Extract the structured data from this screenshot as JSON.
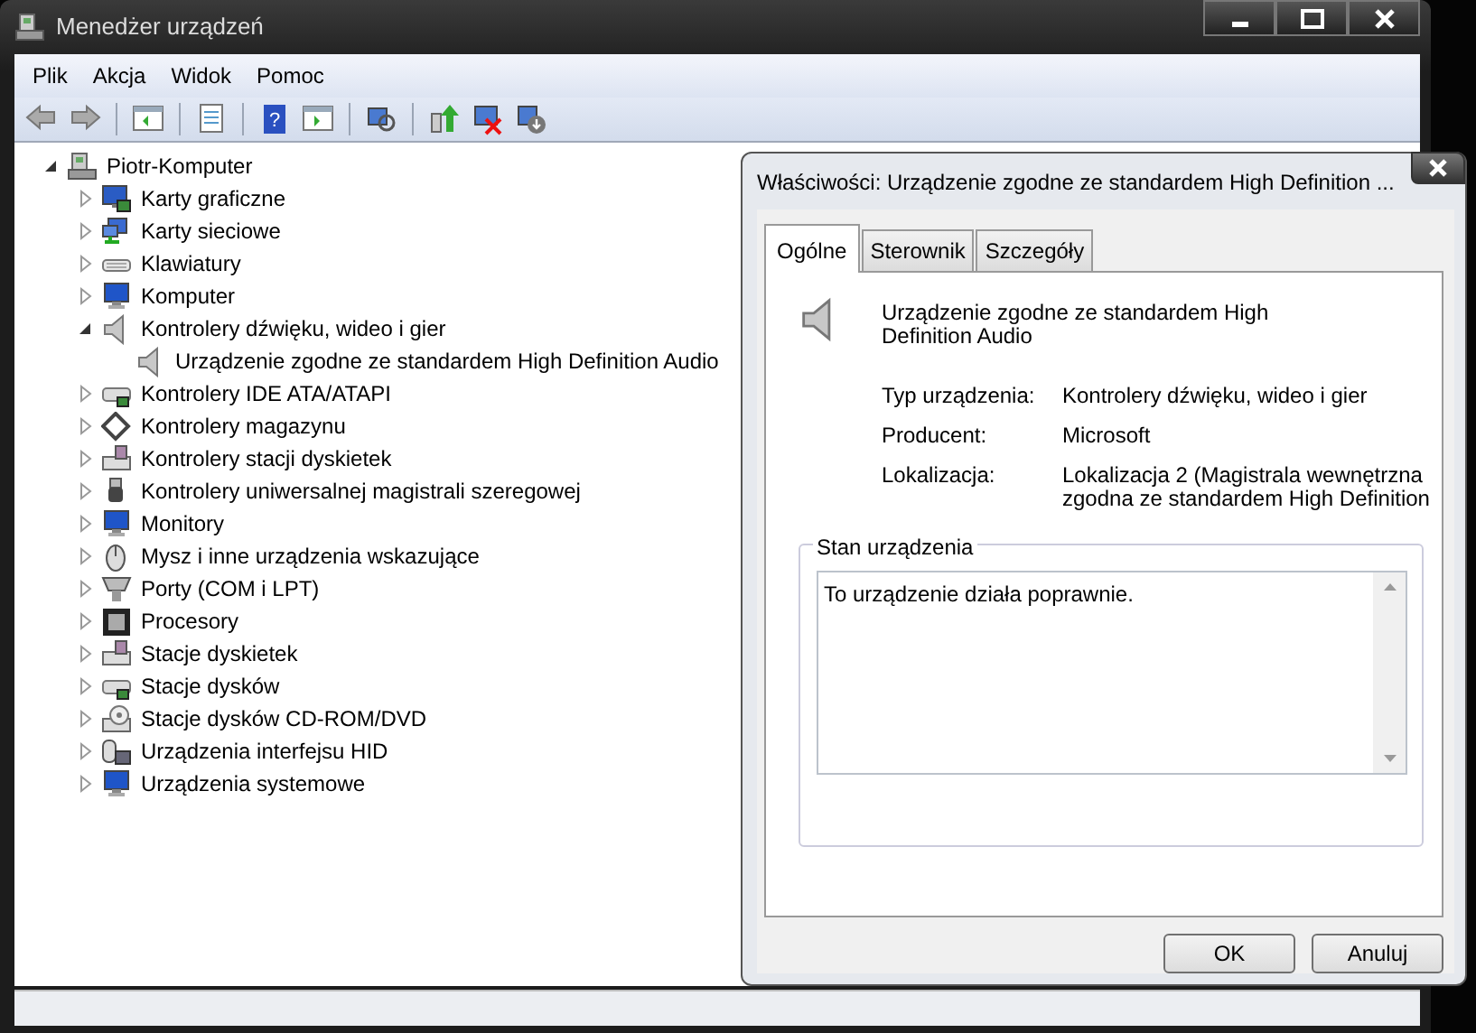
{
  "window": {
    "title": "Menedżer urządzeń"
  },
  "menu": [
    "Plik",
    "Akcja",
    "Widok",
    "Pomoc"
  ],
  "toolbar": [
    [
      {
        "kind": "back"
      },
      {
        "kind": "forward"
      }
    ],
    [
      {
        "kind": "tree-pane"
      }
    ],
    [
      {
        "kind": "properties"
      }
    ],
    [
      {
        "kind": "help",
        "glyph": "?"
      },
      {
        "kind": "action-pane"
      }
    ],
    [
      {
        "kind": "scan"
      }
    ],
    [
      {
        "kind": "update"
      },
      {
        "kind": "uninstall"
      },
      {
        "kind": "disable"
      }
    ]
  ],
  "tree": {
    "label": "Piotr-Komputer",
    "kind": "computer",
    "expanded": true,
    "children": [
      {
        "label": "Karty graficzne",
        "kind": "display",
        "expanded": false
      },
      {
        "label": "Karty sieciowe",
        "kind": "network",
        "expanded": false
      },
      {
        "label": "Klawiatury",
        "kind": "keyboard",
        "expanded": false
      },
      {
        "label": "Komputer",
        "kind": "monitor",
        "expanded": false
      },
      {
        "label": "Kontrolery dźwięku, wideo i gier",
        "kind": "speaker",
        "expanded": true,
        "children": [
          {
            "label": "Urządzenie zgodne ze standardem High Definition Audio",
            "kind": "speaker"
          }
        ]
      },
      {
        "label": "Kontrolery IDE ATA/ATAPI",
        "kind": "drive",
        "expanded": false
      },
      {
        "label": "Kontrolery magazynu",
        "kind": "storage",
        "expanded": false
      },
      {
        "label": "Kontrolery stacji dyskietek",
        "kind": "floppy",
        "expanded": false
      },
      {
        "label": "Kontrolery uniwersalnej magistrali szeregowej",
        "kind": "usb",
        "expanded": false
      },
      {
        "label": "Monitory",
        "kind": "monitor",
        "expanded": false
      },
      {
        "label": "Mysz i inne urządzenia wskazujące",
        "kind": "mouse",
        "expanded": false
      },
      {
        "label": "Porty (COM i LPT)",
        "kind": "port",
        "expanded": false
      },
      {
        "label": "Procesory",
        "kind": "cpu",
        "expanded": false
      },
      {
        "label": "Stacje dyskietek",
        "kind": "floppy",
        "expanded": false
      },
      {
        "label": "Stacje dysków",
        "kind": "drive",
        "expanded": false
      },
      {
        "label": "Stacje dysków CD-ROM/DVD",
        "kind": "cdrom",
        "expanded": false
      },
      {
        "label": "Urządzenia interfejsu HID",
        "kind": "hid",
        "expanded": false
      },
      {
        "label": "Urządzenia systemowe",
        "kind": "monitor",
        "expanded": false
      }
    ]
  },
  "dialog": {
    "title": "Właściwości: Urządzenie zgodne ze standardem High Definition ...",
    "tabs": [
      {
        "label": "Ogólne",
        "selected": true
      },
      {
        "label": "Sterownik",
        "selected": false
      },
      {
        "label": "Szczegóły",
        "selected": false
      }
    ],
    "device_name": "Urządzenie zgodne ze standardem High Definition Audio",
    "properties": [
      {
        "label": "Typ urządzenia:",
        "value": "Kontrolery dźwięku, wideo i gier"
      },
      {
        "label": "Producent:",
        "value": "Microsoft"
      },
      {
        "label": "Lokalizacja:",
        "value": "Lokalizacja 2 (Magistrala wewnętrzna zgodna ze standardem High Definition"
      }
    ],
    "status": {
      "legend": "Stan urządzenia",
      "text": "To urządzenie działa poprawnie."
    },
    "buttons": [
      "OK",
      "Anuluj"
    ]
  }
}
